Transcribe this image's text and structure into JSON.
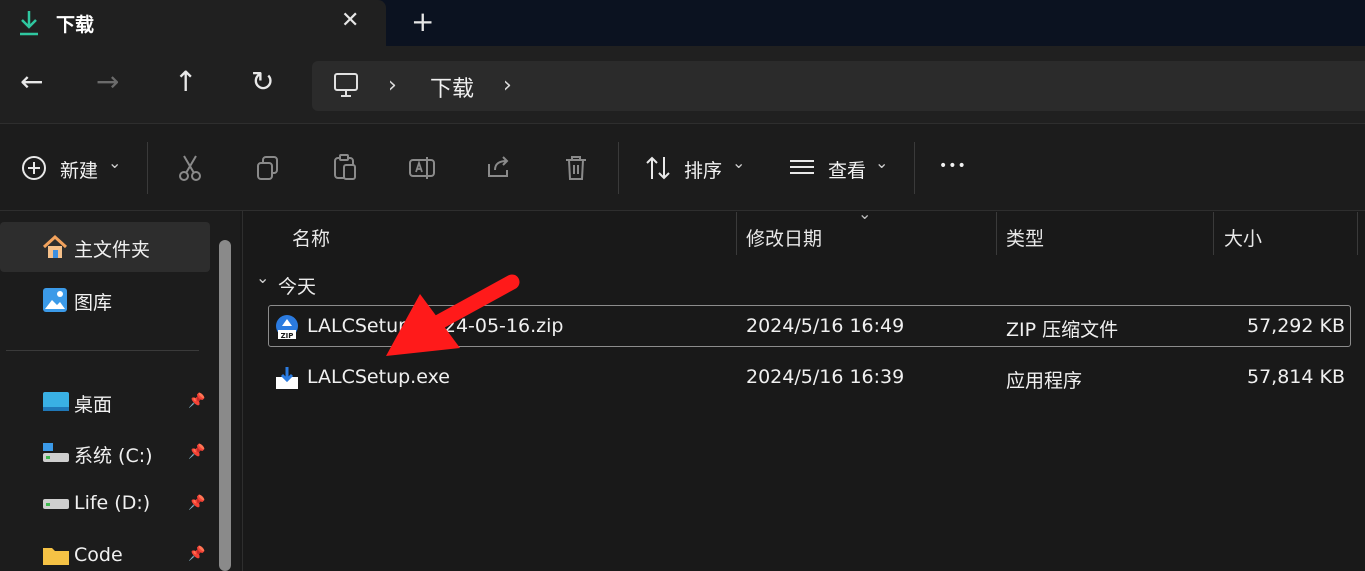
{
  "tab": {
    "title": "下载",
    "close_glyph": "✕",
    "new_glyph": "+"
  },
  "nav": {
    "back_glyph": "←",
    "forward_glyph": "→",
    "up_glyph": "↑",
    "refresh_glyph": "↻",
    "breadcrumb": {
      "separator": "›",
      "current": "下载"
    }
  },
  "toolbar": {
    "new_label": "新建",
    "sort_label": "排序",
    "view_label": "查看",
    "more_glyph": "•••",
    "chevron": "⌄"
  },
  "sidebar": {
    "items": [
      {
        "label": "主文件夹",
        "icon": "home-icon"
      },
      {
        "label": "图库",
        "icon": "gallery-icon"
      },
      {
        "label": "桌面",
        "icon": "desktop-icon",
        "pinned": true
      },
      {
        "label": "系统 (C:)",
        "icon": "drive-icon",
        "pinned": true
      },
      {
        "label": "Life (D:)",
        "icon": "drive-icon",
        "pinned": true
      },
      {
        "label": "Code",
        "icon": "folder-icon",
        "pinned": true
      }
    ],
    "pin_glyph": "📌"
  },
  "columns": {
    "name": "名称",
    "modified": "修改日期",
    "type": "类型",
    "size": "大小"
  },
  "group": {
    "label": "今天",
    "chevron": "⌄"
  },
  "files": [
    {
      "name": "LALCSetup_2024-05-16.zip",
      "modified": "2024/5/16 16:49",
      "type": "ZIP 压缩文件",
      "size": "57,292 KB",
      "icon": "zip-icon"
    },
    {
      "name": "LALCSetup.exe",
      "modified": "2024/5/16 16:39",
      "type": "应用程序",
      "size": "57,814 KB",
      "icon": "installer-icon"
    }
  ],
  "annotation_color": "#ff1a1a",
  "accent_color": "#4cc2ff"
}
